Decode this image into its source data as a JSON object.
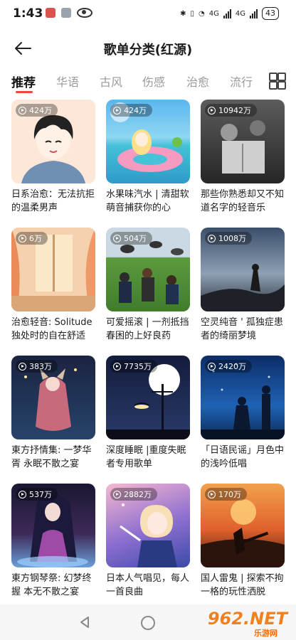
{
  "status": {
    "time": "1:43",
    "net_a": "4G",
    "net_b": "4G",
    "battery": "43"
  },
  "header": {
    "title": "歌单分类(红源)"
  },
  "tabs": [
    {
      "label": "推荐"
    },
    {
      "label": "华语"
    },
    {
      "label": "古风"
    },
    {
      "label": "伤感"
    },
    {
      "label": "治愈"
    },
    {
      "label": "流行"
    }
  ],
  "icons": {
    "back": "arrow-left-icon",
    "grid": "grid-icon",
    "play": "play-circle-icon"
  },
  "playlists": [
    {
      "plays": "424万",
      "title": "日系治愈：无法抗拒的温柔男声"
    },
    {
      "plays": "424万",
      "title": "水果味汽水 | 清甜软萌音捕获你的心"
    },
    {
      "plays": "10942万",
      "title": "那些你熟悉却又不知道名字的轻音乐"
    },
    {
      "plays": "6万",
      "title": "治愈轻音: Solitude独处时的自在舒适"
    },
    {
      "plays": "504万",
      "title": "可爱摇滚 | 一剂抵挡春困的上好良药"
    },
    {
      "plays": "1008万",
      "title": "空灵纯音 ' 孤独症患者的绮丽梦境"
    },
    {
      "plays": "383万",
      "title": "東方抒情集: 一梦华胥 永眠不散之宴"
    },
    {
      "plays": "7735万",
      "title": "深度睡眠 |重度失眠者专用歌单"
    },
    {
      "plays": "2420万",
      "title": "「日语民谣」月色中的浅吟低唱"
    },
    {
      "plays": "537万",
      "title": "東方钢琴祭: 幻梦终握 本无不散之宴"
    },
    {
      "plays": "2882万",
      "title": "日本人气唱见，每人一首良曲"
    },
    {
      "plays": "170万",
      "title": "国人雷鬼 | 探索不拘一格的玩性洒脱"
    }
  ],
  "watermark": {
    "top": "962.NET",
    "bottom": "乐游网"
  }
}
